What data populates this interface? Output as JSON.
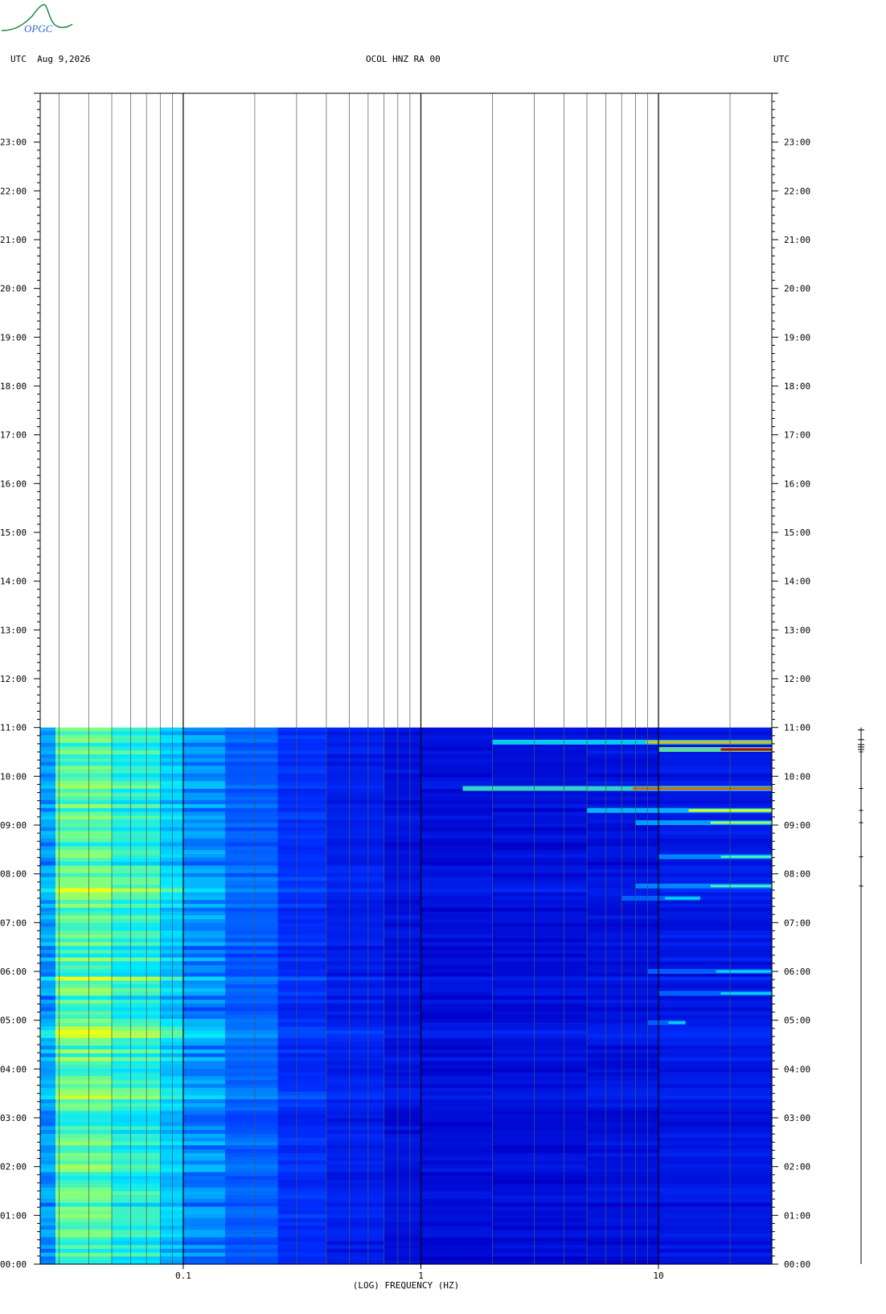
{
  "header": {
    "left": "UTC  Aug 9,2026",
    "center": "OCOL HNZ RA 00",
    "right": "UTC"
  },
  "logo": {
    "text": "OPGC",
    "color": "#1a8a3a"
  },
  "chart_data": {
    "type": "heatmap",
    "xlabel": "(LOG) FREQUENCY (HZ)",
    "x_scale": "log",
    "xlim": [
      0.025,
      30
    ],
    "x_ticks": [
      {
        "value": 0.1,
        "label": "0.1"
      },
      {
        "value": 1,
        "label": "1"
      },
      {
        "value": 10,
        "label": "10"
      }
    ],
    "y_unit": "hours UTC",
    "ylim": [
      0,
      24
    ],
    "y_ticks": [
      {
        "value": 0,
        "label": "00:00"
      },
      {
        "value": 1,
        "label": "01:00"
      },
      {
        "value": 2,
        "label": "02:00"
      },
      {
        "value": 3,
        "label": "03:00"
      },
      {
        "value": 4,
        "label": "04:00"
      },
      {
        "value": 5,
        "label": "05:00"
      },
      {
        "value": 6,
        "label": "06:00"
      },
      {
        "value": 7,
        "label": "07:00"
      },
      {
        "value": 8,
        "label": "08:00"
      },
      {
        "value": 9,
        "label": "09:00"
      },
      {
        "value": 10,
        "label": "10:00"
      },
      {
        "value": 11,
        "label": "11:00"
      },
      {
        "value": 12,
        "label": "12:00"
      },
      {
        "value": 13,
        "label": "13:00"
      },
      {
        "value": 14,
        "label": "14:00"
      },
      {
        "value": 15,
        "label": "15:00"
      },
      {
        "value": 16,
        "label": "16:00"
      },
      {
        "value": 17,
        "label": "17:00"
      },
      {
        "value": 18,
        "label": "18:00"
      },
      {
        "value": 19,
        "label": "19:00"
      },
      {
        "value": 20,
        "label": "20:00"
      },
      {
        "value": 21,
        "label": "21:00"
      },
      {
        "value": 22,
        "label": "22:00"
      },
      {
        "value": 23,
        "label": "23:00"
      }
    ],
    "data_extent_hours": [
      0,
      11
    ],
    "colormap": [
      "#0000c8",
      "#0030ff",
      "#00a0ff",
      "#00e8ff",
      "#80ff80",
      "#ffff00",
      "#ff8000",
      "#c00000"
    ],
    "events": [
      {
        "time": 10.7,
        "fmin": 2,
        "fmax": 30,
        "level": 0.8
      },
      {
        "time": 10.55,
        "fmin": 10,
        "fmax": 30,
        "level": 1.0
      },
      {
        "time": 9.75,
        "fmin": 1.5,
        "fmax": 30,
        "level": 0.9
      },
      {
        "time": 9.3,
        "fmin": 5,
        "fmax": 30,
        "level": 0.7
      },
      {
        "time": 9.05,
        "fmin": 8,
        "fmax": 30,
        "level": 0.6
      },
      {
        "time": 8.35,
        "fmin": 10,
        "fmax": 30,
        "level": 0.5
      },
      {
        "time": 7.75,
        "fmin": 8,
        "fmax": 30,
        "level": 0.5
      },
      {
        "time": 7.5,
        "fmin": 7,
        "fmax": 15,
        "level": 0.4
      },
      {
        "time": 6.0,
        "fmin": 9,
        "fmax": 30,
        "level": 0.4
      },
      {
        "time": 5.55,
        "fmin": 10,
        "fmax": 30,
        "level": 0.4
      },
      {
        "time": 4.95,
        "fmin": 9,
        "fmax": 13,
        "level": 0.4
      }
    ]
  }
}
